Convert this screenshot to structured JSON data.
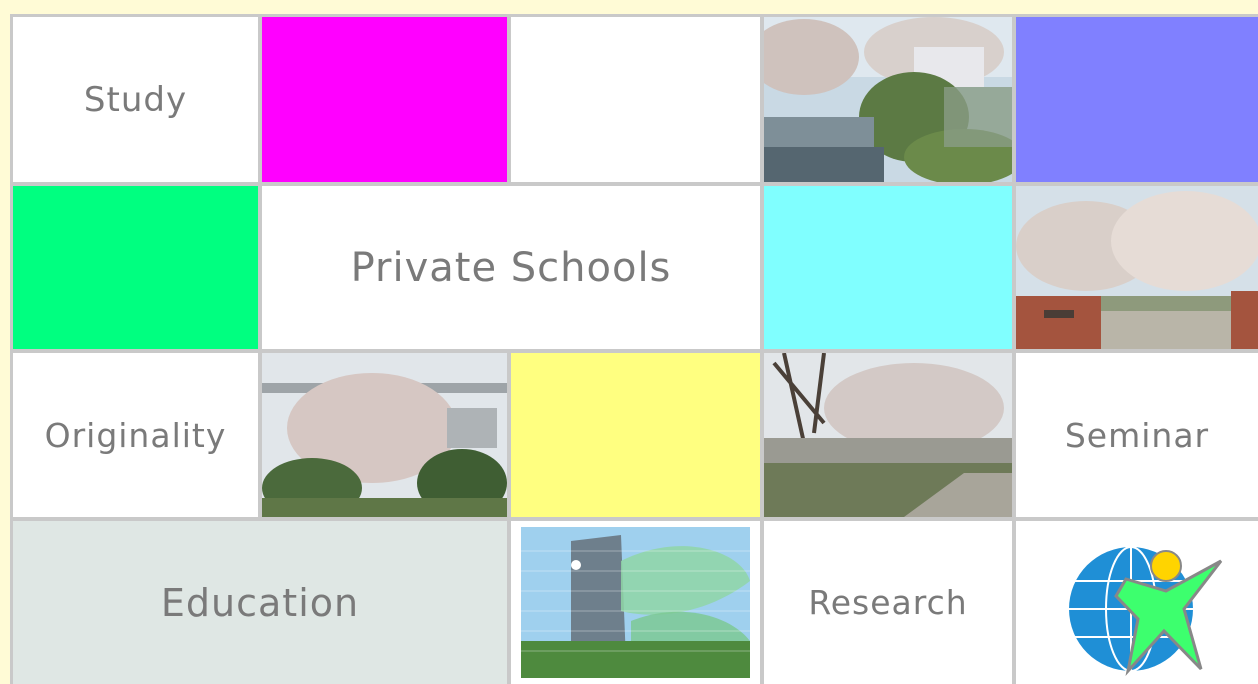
{
  "grid": {
    "labels": {
      "study": "Study",
      "private_schools": "Private Schools",
      "originality": "Originality",
      "seminar": "Seminar",
      "education": "Education",
      "research": "Research"
    },
    "colors": {
      "magenta": "#ff00ff",
      "periwinkle": "#8080ff",
      "green": "#00ff80",
      "cyan": "#80ffff",
      "yellow": "#ffff80",
      "education_bg": "#dfe7e4",
      "text": "#7a7a7a",
      "grid_line": "#c9c9c9",
      "page_bg": "#fffbd6"
    },
    "photos": [
      {
        "name": "photo-river-cherry-blossoms"
      },
      {
        "name": "photo-cherry-trees-gate"
      },
      {
        "name": "photo-blossom-tree-bridge"
      },
      {
        "name": "photo-bare-trees-park"
      },
      {
        "name": "photo-campus-building-leaves"
      }
    ],
    "logo": {
      "icon": "globe-star-person-icon"
    }
  }
}
